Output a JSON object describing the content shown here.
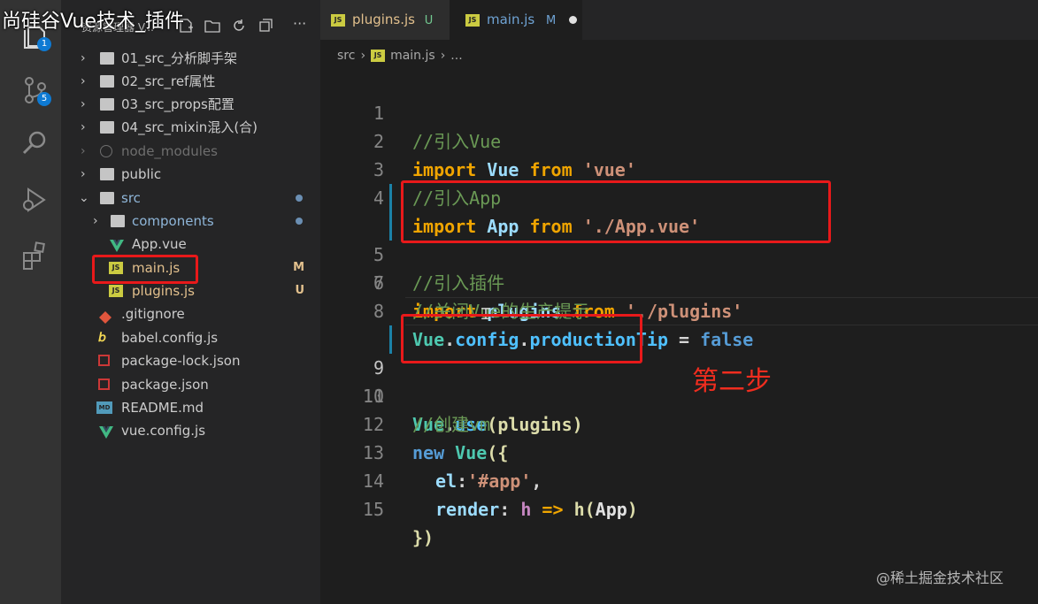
{
  "video_title": "尚硅谷Vue技术_插件",
  "activity_bar": {
    "explorer_badge": "1",
    "scm_badge": "5"
  },
  "sidebar": {
    "title": "资源管理器 V...",
    "items": [
      {
        "label": "01_src_分析脚手架",
        "type": "folder"
      },
      {
        "label": "02_src_ref属性",
        "type": "folder"
      },
      {
        "label": "03_src_props配置",
        "type": "folder"
      },
      {
        "label": "04_src_mixin混入(合)",
        "type": "folder"
      },
      {
        "label": "node_modules",
        "type": "folder"
      },
      {
        "label": "public",
        "type": "folder"
      },
      {
        "label": "src",
        "type": "folder-open"
      },
      {
        "label": "components",
        "type": "folder"
      },
      {
        "label": "App.vue",
        "type": "vue"
      },
      {
        "label": "main.js",
        "type": "js",
        "decoration": "M"
      },
      {
        "label": "plugins.js",
        "type": "js",
        "decoration": "U"
      },
      {
        "label": ".gitignore",
        "type": "git"
      },
      {
        "label": "babel.config.js",
        "type": "babel"
      },
      {
        "label": "package-lock.json",
        "type": "npm"
      },
      {
        "label": "package.json",
        "type": "npm"
      },
      {
        "label": "README.md",
        "type": "md"
      },
      {
        "label": "vue.config.js",
        "type": "vue"
      }
    ]
  },
  "tabs": [
    {
      "label": "plugins.js",
      "status": "U",
      "icon": "JS"
    },
    {
      "label": "main.js",
      "status": "M",
      "icon": "JS"
    }
  ],
  "breadcrumb": {
    "folder": "src",
    "file": "main.js",
    "more": "..."
  },
  "editor": {
    "line_numbers": [
      "1",
      "2",
      "3",
      "4",
      "5",
      "6",
      "7",
      "8",
      "9",
      "10",
      "11",
      "12",
      "13",
      "14",
      "15"
    ],
    "l1": "//引入Vue",
    "l2": {
      "kw": "import",
      "id": "Vue",
      "from": "from",
      "str": "'vue'"
    },
    "l3": "//引入App",
    "l4": {
      "kw": "import",
      "id": "App",
      "from": "from",
      "str": "'./App.vue'"
    },
    "l5": "//引入插件",
    "l6": {
      "kw": "import",
      "id": "plugins",
      "from": "from",
      "str": "'./plugins'"
    },
    "l7": "//关闭Vue的生产提示",
    "l8": {
      "obj": "Vue",
      "dot1": ".",
      "p1": "config",
      "dot2": ".",
      "p2": "productionTip",
      "eq": " = ",
      "val": "false"
    },
    "l10": {
      "obj": "Vue",
      "dot": ".",
      "fn": "use",
      "open": "(",
      "arg": "plugins",
      "close": ")"
    },
    "l11": "//创建vm",
    "l12": {
      "kw": "new",
      "cls": "Vue",
      "rest": "({"
    },
    "l13": {
      "key": "el",
      "colon": ":",
      "str": "'#app'",
      "comma": ","
    },
    "l14": {
      "key": "render",
      "colon": ": ",
      "param": "h",
      "arrow": " => ",
      "fn": "h",
      "open": "(",
      "arg": "App",
      "close": ")"
    },
    "l15": "})"
  },
  "annotation": "第二步",
  "watermark": "@稀土掘金技术社区",
  "colors": {
    "annotation_red": "#e8191a",
    "accent": "#0e7ad3"
  }
}
